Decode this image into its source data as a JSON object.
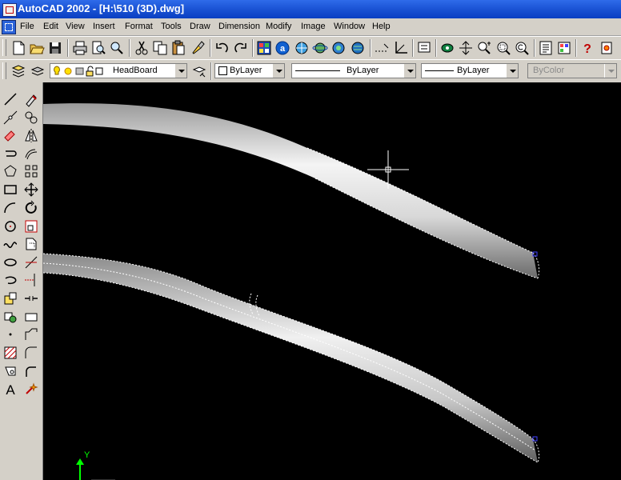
{
  "window": {
    "title": "AutoCAD 2002 - [H:\\510 (3D).dwg]"
  },
  "menu": {
    "items": [
      "File",
      "Edit",
      "View",
      "Insert",
      "Format",
      "Tools",
      "Draw",
      "Dimension",
      "Modify",
      "Image",
      "Window",
      "Help"
    ]
  },
  "standard_toolbar": {
    "icons": [
      "new-icon",
      "open-icon",
      "save-icon",
      "print-icon",
      "print-preview-icon",
      "find-icon",
      "cut-icon",
      "copy-icon",
      "paste-icon",
      "match-properties-icon",
      "undo-icon",
      "redo-icon",
      "design-center-icon",
      "autocad-today-icon",
      "browse-web-icon",
      "3d-orbit-icon",
      "publish-web-icon",
      "distance-icon",
      "ucs-icon",
      "named-views-icon",
      "redraw-icon",
      "pan-icon",
      "zoom-realtime-icon",
      "zoom-window-icon",
      "zoom-previous-icon",
      "properties-icon",
      "tool-palette-icon",
      "help-icon",
      "pin-icon"
    ]
  },
  "properties_toolbar": {
    "layer_value": "HeadBoard",
    "color_value": "ByLayer",
    "linetype_value": "ByLayer",
    "lineweight_value": "ByLayer",
    "plotstyle_value": "ByColor"
  },
  "left_toolbar": {
    "draw_icons": [
      "line-icon",
      "construction-line-icon",
      "multiline-icon",
      "polyline-icon",
      "polygon-icon",
      "rectangle-icon",
      "arc-icon",
      "circle-icon",
      "spline-icon",
      "ellipse-icon",
      "ellipse-arc-icon",
      "insert-block-icon",
      "make-block-icon",
      "point-icon",
      "hatch-icon",
      "region-icon",
      "multiline-text-icon"
    ],
    "modify_icons": [
      "erase-icon",
      "copy-object-icon",
      "mirror-icon",
      "offset-icon",
      "array-icon",
      "move-icon",
      "rotate-icon",
      "scale-icon",
      "stretch-icon",
      "trim-icon",
      "extend-icon",
      "break-icon",
      "break-at-point-icon",
      "chamfer-icon",
      "fillet-icon",
      "explode-icon"
    ]
  },
  "canvas": {
    "background": "#000000",
    "ucs_y_label": "Y"
  }
}
